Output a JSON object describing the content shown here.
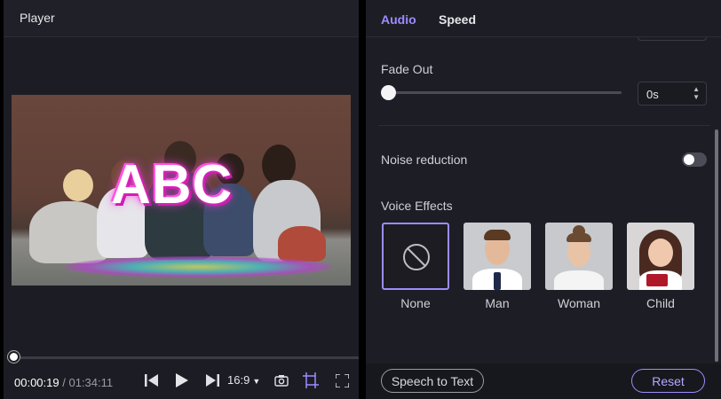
{
  "player": {
    "title": "Player",
    "overlay_text": "ABC",
    "progress": 0.0036,
    "time_current": "00:00:19",
    "time_separator": "/",
    "time_total": "01:34:11",
    "aspect_ratio": "16:9"
  },
  "audio_panel": {
    "tabs": [
      {
        "label": "Audio",
        "active": true
      },
      {
        "label": "Speed",
        "active": false
      }
    ],
    "fade_out": {
      "label": "Fade Out",
      "value": "0s",
      "slider_fraction": 0
    },
    "noise_reduction": {
      "label": "Noise reduction",
      "enabled": false
    },
    "voice_effects": {
      "label": "Voice Effects",
      "items": [
        {
          "name": "None",
          "selected": true,
          "icon": "no-effect-icon"
        },
        {
          "name": "Man",
          "selected": false
        },
        {
          "name": "Woman",
          "selected": false
        },
        {
          "name": "Child",
          "selected": false
        }
      ]
    },
    "speech_to_text_label": "Speech to Text",
    "reset_label": "Reset"
  },
  "colors": {
    "accent": "#9c8cff",
    "panel_bg": "#1d1e25",
    "player_bg": "#1c1d24"
  }
}
